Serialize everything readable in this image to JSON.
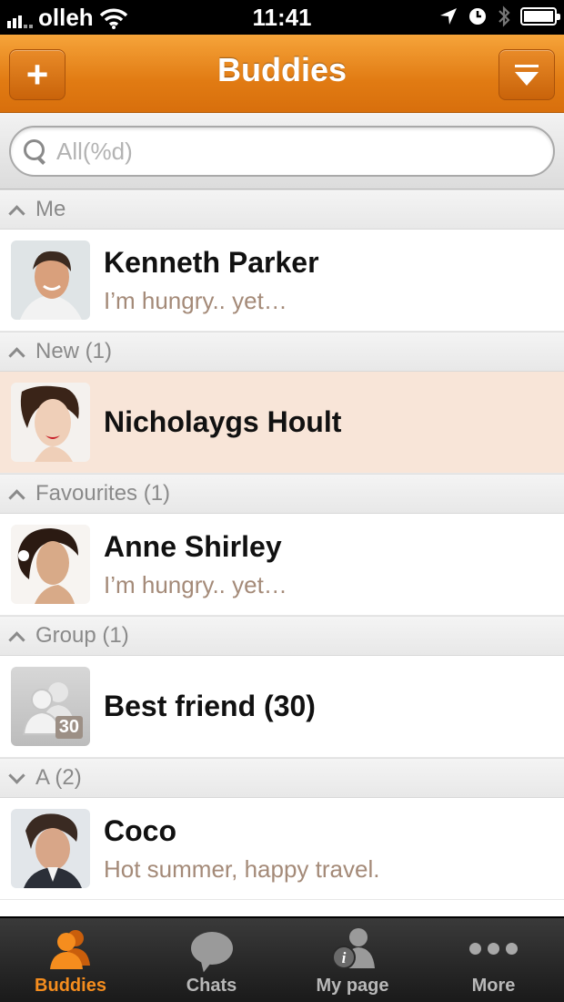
{
  "status_bar": {
    "carrier": "olleh",
    "time": "11:41"
  },
  "nav": {
    "title": "Buddies",
    "add_label": "+"
  },
  "search": {
    "placeholder": "All(%d)"
  },
  "sections": {
    "me": "Me",
    "new": "New (1)",
    "favourites": "Favourites (1)",
    "group": "Group (1)",
    "a": "A (2)"
  },
  "buddies": {
    "me": {
      "name": "Kenneth Parker",
      "status": "I’m hungry.. yet…"
    },
    "new": {
      "name": "Nicholaygs Hoult"
    },
    "favourite": {
      "name": "Anne Shirley",
      "status": "I’m hungry.. yet…"
    },
    "group": {
      "name": "Best friend (30)",
      "badge": "30"
    },
    "a1": {
      "name": "Coco",
      "status": "Hot summer, happy travel."
    }
  },
  "tabs": [
    {
      "label": "Buddies",
      "icon": "buddies-icon",
      "active": true
    },
    {
      "label": "Chats",
      "icon": "chat-bubble-icon",
      "active": false
    },
    {
      "label": "My page",
      "icon": "my-page-icon",
      "active": false
    },
    {
      "label": "More",
      "icon": "more-dots-icon",
      "active": false
    }
  ],
  "colors": {
    "accent": "#e8831a",
    "highlight_row": "#f8e5d8",
    "active_tab": "#f58d1e",
    "status_text": "#a48a78"
  }
}
